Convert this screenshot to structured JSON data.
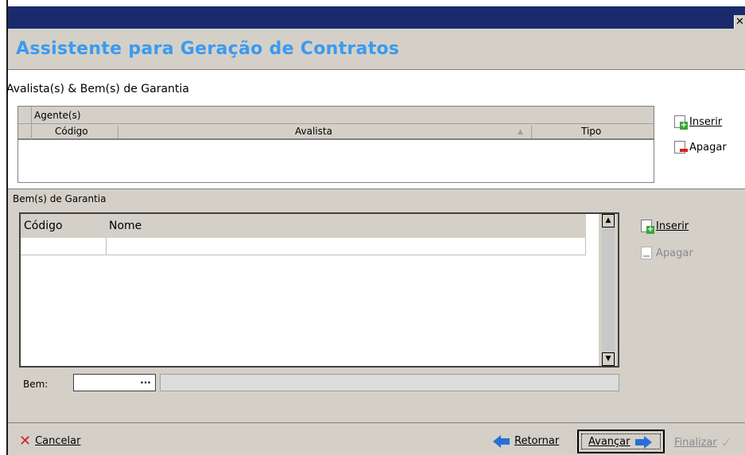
{
  "window": {
    "close_glyph": "✕"
  },
  "header": {
    "title": "Assistente para Geração de Contratos"
  },
  "section": {
    "title": "Avalista(s) & Bem(s) de Garantia"
  },
  "agentes_grid": {
    "group_label": "Agente(s)",
    "columns": [
      "Código",
      "Avalista",
      "Tipo"
    ],
    "sort_indicator": "▲"
  },
  "agentes_actions": {
    "inserir": "Inserir",
    "apagar": "Apagar"
  },
  "bens": {
    "section_label": "Bem(s) de Garantia",
    "columns": [
      "Código",
      "Nome"
    ],
    "inserir": "Inserir",
    "apagar": "Apagar",
    "bem_label": "Bem:",
    "ellipsis": "...",
    "scroll_up": "▲",
    "scroll_down": "▼"
  },
  "footer": {
    "cancelar": "Cancelar",
    "retornar": "Retornar",
    "avancar": "Avançar",
    "finalizar": "Finalizar"
  },
  "colors": {
    "title_bar": "#1a2a6c",
    "header_title": "#3a9af0",
    "panel_bg": "#d4d0c8"
  }
}
